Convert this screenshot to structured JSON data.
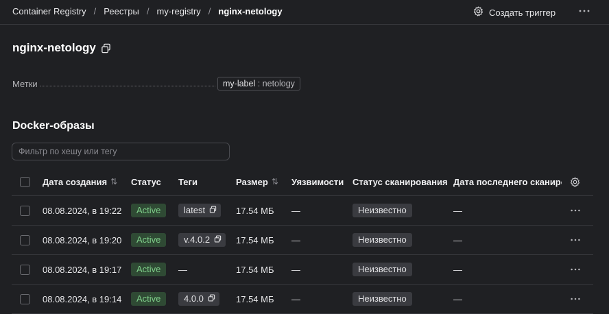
{
  "breadcrumbs": [
    {
      "label": "Container Registry"
    },
    {
      "label": "Реестры"
    },
    {
      "label": "my-registry"
    },
    {
      "label": "nginx-netology"
    }
  ],
  "breadcrumb_separator": "/",
  "header": {
    "trigger_label": "Создать триггер",
    "trigger_icon": "gear-icon",
    "more_icon": "more-horizontal-icon"
  },
  "page_title": "nginx-netology",
  "labels": {
    "caption": "Метки",
    "items": [
      {
        "key": "my-label",
        "sep": " : ",
        "value": "netology"
      }
    ]
  },
  "section_title": "Docker-образы",
  "filter": {
    "placeholder": "Фильтр по хешу или тегу",
    "value": ""
  },
  "table": {
    "columns": {
      "created": "Дата создания",
      "status": "Статус",
      "tags": "Теги",
      "size": "Размер",
      "vulns": "Уязвимости",
      "scan_status": "Статус сканирования",
      "last_scan": "Дата последнего сканирования"
    },
    "sort_icon": "⇅",
    "rows": [
      {
        "created": "08.08.2024, в 19:22",
        "status": "Active",
        "tag": "latest",
        "size": "17.54 МБ",
        "vulns": "—",
        "scan_status": "Неизвестно",
        "last_scan": "—"
      },
      {
        "created": "08.08.2024, в 19:20",
        "status": "Active",
        "tag": "v.4.0.2",
        "size": "17.54 МБ",
        "vulns": "—",
        "scan_status": "Неизвестно",
        "last_scan": "—"
      },
      {
        "created": "08.08.2024, в 19:17",
        "status": "Active",
        "tag": "",
        "tag_empty": "—",
        "size": "17.54 МБ",
        "vulns": "—",
        "scan_status": "Неизвестно",
        "last_scan": "—"
      },
      {
        "created": "08.08.2024, в 19:14",
        "status": "Active",
        "tag": "4.0.0",
        "size": "17.54 МБ",
        "vulns": "—",
        "scan_status": "Неизвестно",
        "last_scan": "—"
      }
    ]
  },
  "colors": {
    "background": "#1f2023",
    "active_badge_bg": "#2f4a34",
    "active_badge_text": "#7fcf8a",
    "neutral_badge_bg": "#3a3b40"
  }
}
